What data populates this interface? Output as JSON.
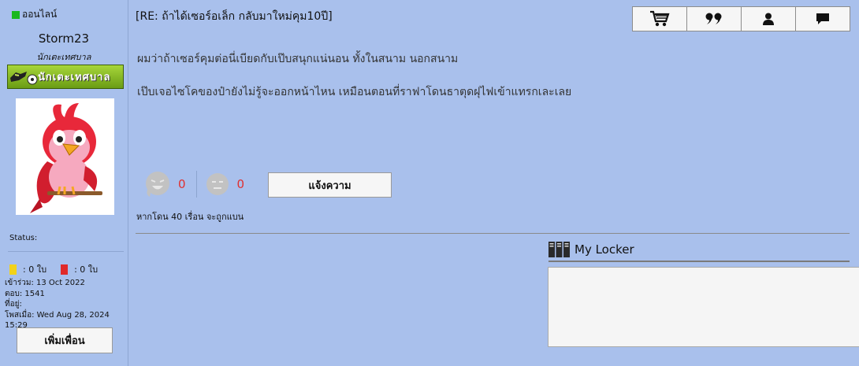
{
  "user": {
    "online_label": "ออนไลน์",
    "username": "Storm23",
    "title": "นักเตะเทศบาล",
    "rank_badge_text": "นักเตะเทศบาล",
    "status_label": "Status:",
    "yellow_cards": ": 0 ใบ",
    "red_cards": ": 0 ใบ",
    "joined": "เข้าร่วม: 13 Oct 2022",
    "replies": "ตอบ: 1541",
    "location": "ที่อยู่:",
    "posted": "โพสเมื่อ: Wed Aug 28, 2024 15:29",
    "add_friend_label": "เพิ่มเพื่อน"
  },
  "post": {
    "title": "[RE: ถ้าได้เซอร์อเล็ก กลับมาใหม่คุม10ปี]",
    "paragraphs": [
      "ผมว่าถ้าเซอร์คุมต่อนี่เบียดกับเป๊บสนุกแน่นอน ทั้งในสนาม นอกสนาม",
      "เป๊บเจอไซโคของป๋ายังไม่รู้จะออกหน้าไหน เหมือนตอนที่ราฟาโดนธาตุดฝุไฟเข้าแทรกเละเลย"
    ],
    "like_count": "0",
    "dislike_count": "0",
    "report_label": "แจ้งความ",
    "ban_warning": "หากโดน 40 เรื่อน จะถูกแบน"
  },
  "locker": {
    "title": "My Locker"
  },
  "colors": {
    "online": "#19b81f",
    "yellow_card": "#f2d21a",
    "red_card": "#e02a2a",
    "count": "#e03030"
  }
}
